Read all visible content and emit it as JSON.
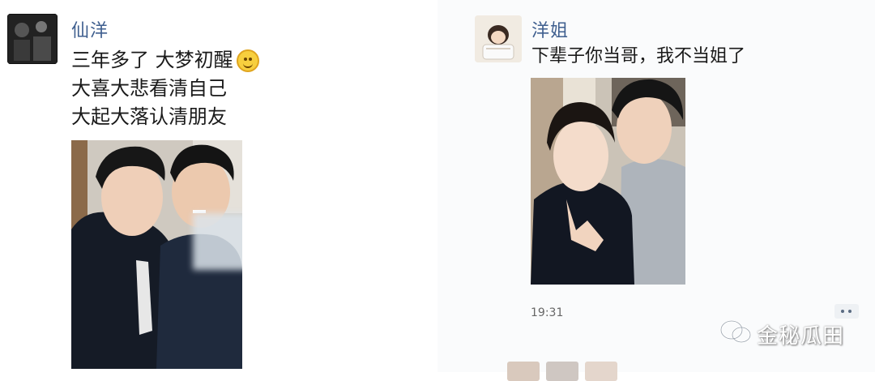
{
  "left_post": {
    "author": "仙洋",
    "lines": [
      "三年多了 大梦初醒",
      "大喜大悲看清自己",
      "大起大落认清朋友"
    ],
    "emoji_icon": "grin-emoji-icon"
  },
  "right_post": {
    "author": "洋姐",
    "text": "下辈子你当哥，我不当姐了",
    "time": "19:31"
  },
  "watermark": {
    "text": "金秘瓜田"
  },
  "colors": {
    "name_link": "#3f5f8f",
    "text": "#1a1a1a"
  }
}
